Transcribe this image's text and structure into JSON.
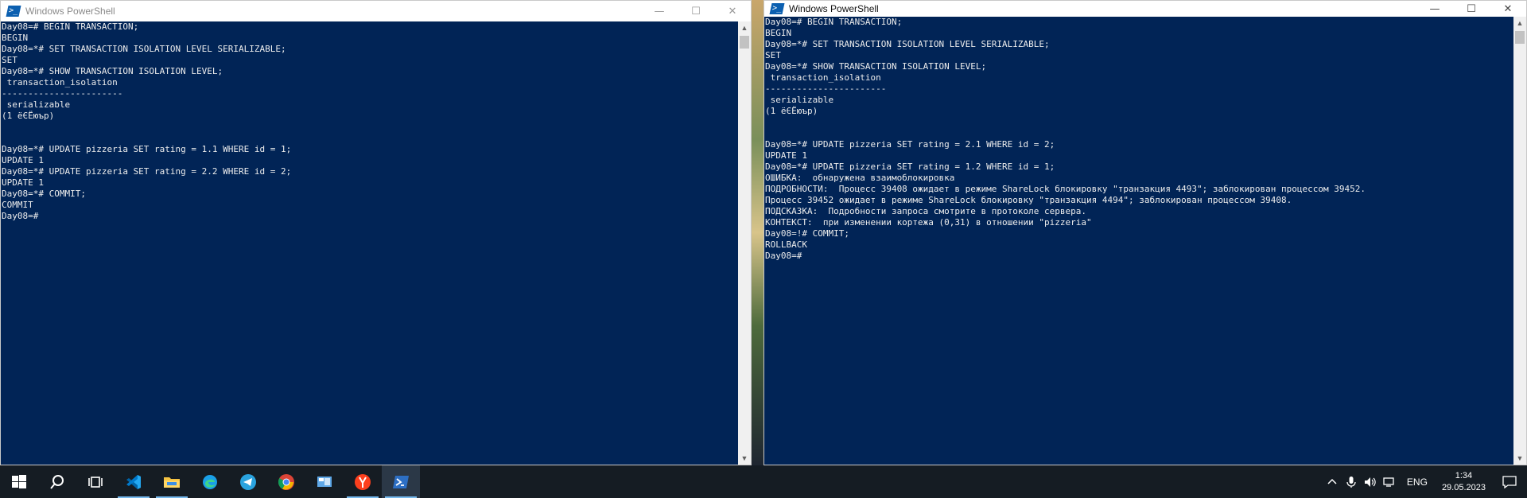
{
  "left_window": {
    "title": "Windows PowerShell",
    "console_text": "Day08=# BEGIN TRANSACTION;\nBEGIN\nDay08=*# SET TRANSACTION ISOLATION LEVEL SERIALIZABLE;\nSET\nDay08=*# SHOW TRANSACTION ISOLATION LEVEL;\n transaction_isolation\n-----------------------\n serializable\n(1 ёЄЁюър)\n\n\nDay08=*# UPDATE pizzeria SET rating = 1.1 WHERE id = 1;\nUPDATE 1\nDay08=*# UPDATE pizzeria SET rating = 2.2 WHERE id = 2;\nUPDATE 1\nDay08=*# COMMIT;\nCOMMIT\nDay08=#"
  },
  "right_window": {
    "title": "Windows PowerShell",
    "console_text": "Day08=# BEGIN TRANSACTION;\nBEGIN\nDay08=*# SET TRANSACTION ISOLATION LEVEL SERIALIZABLE;\nSET\nDay08=*# SHOW TRANSACTION ISOLATION LEVEL;\n transaction_isolation\n-----------------------\n serializable\n(1 ёЄЁюър)\n\n\nDay08=*# UPDATE pizzeria SET rating = 2.1 WHERE id = 2;\nUPDATE 1\nDay08=*# UPDATE pizzeria SET rating = 1.2 WHERE id = 1;\nОШИБКА:  обнаружена взаимоблокировка\nПОДРОБНОСТИ:  Процесс 39408 ожидает в режиме ShareLock блокировку \"транзакция 4493\"; заблокирован процессом 39452.\nПроцесс 39452 ожидает в режиме ShareLock блокировку \"транзакция 4494\"; заблокирован процессом 39408.\nПОДСКАЗКА:  Подробности запроса смотрите в протоколе сервера.\nКОНТЕКСТ:  при изменении кортежа (0,31) в отношении \"pizzeria\"\nDay08=!# COMMIT;\nROLLBACK\nDay08=#"
  },
  "window_controls": {
    "minimize": "—",
    "maximize": "☐",
    "close": "✕"
  },
  "taskbar": {
    "apps": [
      {
        "name": "start",
        "icon": "windows-logo-icon"
      },
      {
        "name": "search",
        "icon": "search-icon"
      },
      {
        "name": "task-view",
        "icon": "task-view-icon"
      },
      {
        "name": "vscode",
        "icon": "vscode-icon",
        "running": true
      },
      {
        "name": "file-explorer",
        "icon": "folder-icon",
        "running": true
      },
      {
        "name": "edge",
        "icon": "edge-icon"
      },
      {
        "name": "telegram",
        "icon": "telegram-icon"
      },
      {
        "name": "chrome",
        "icon": "chrome-icon"
      },
      {
        "name": "control-panel",
        "icon": "control-panel-icon"
      },
      {
        "name": "yandex",
        "icon": "yandex-icon",
        "running": true
      },
      {
        "name": "powershell",
        "icon": "powershell-icon",
        "running": true,
        "active": true
      }
    ],
    "language": "ENG",
    "time": "1:34",
    "date": "29.05.2023",
    "colors": {
      "taskbar_bg": "#151c23",
      "console_bg": "#012456",
      "running_indicator": "#76b9ed"
    }
  }
}
